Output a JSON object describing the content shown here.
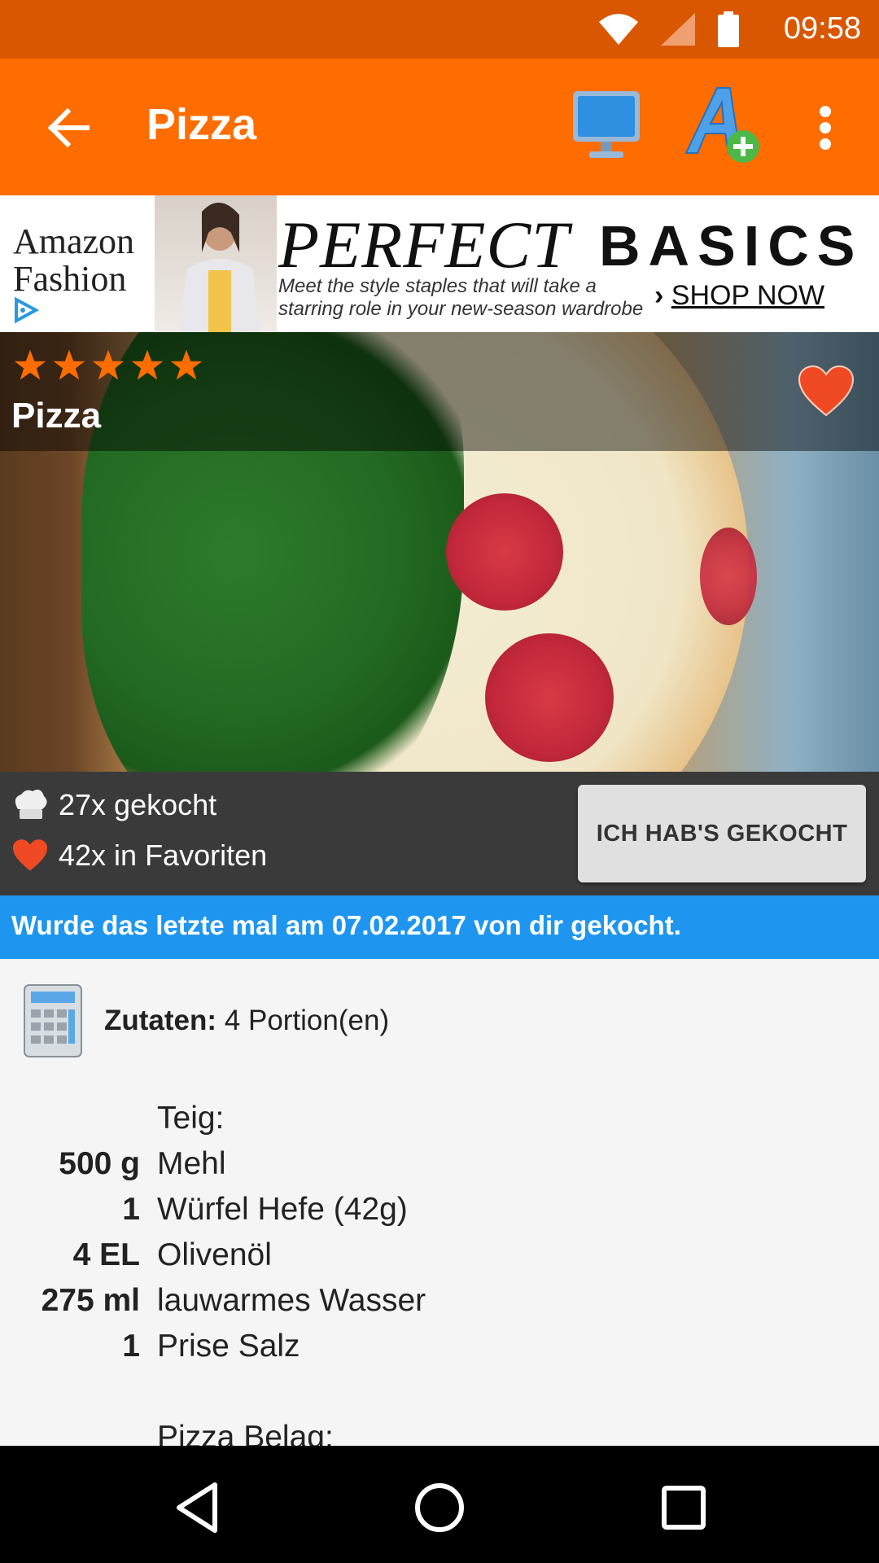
{
  "status_bar": {
    "time": "09:58",
    "wifi_icon": "wifi-icon",
    "signal_icon": "signal-icon",
    "battery_icon": "battery-icon"
  },
  "app_bar": {
    "title": "Pizza",
    "back_icon": "arrow-back-icon",
    "tv_icon": "monitor-icon",
    "font_icon": "font-size-plus-icon",
    "more_icon": "more-vert-icon",
    "color": "#ff6d00"
  },
  "ad": {
    "brand": "Amazon Fashion",
    "headline_1": "PERFECT",
    "headline_2": "BASICS",
    "subtext": "Meet the style staples that will take a starring role in your new-season wardrobe",
    "cta": "SHOP NOW",
    "cta_prefix": "›"
  },
  "recipe": {
    "title": "Pizza",
    "rating": 5,
    "rating_max": 5,
    "star_color": "#ff6d00",
    "favorited": true
  },
  "stats": {
    "cooked_count": "27x gekocht",
    "favorites_count": "42x in Favoriten",
    "cooked_button": "ICH HAB'S GEKOCHT"
  },
  "info_bar": {
    "text": "Wurde das letzte mal am 07.02.2017 von dir gekocht.",
    "color": "#1e96f0"
  },
  "ingredients": {
    "label": "Zutaten:",
    "portions": "4 Portion(en)",
    "items": [
      {
        "qty": "",
        "name": "Teig:"
      },
      {
        "qty": "500 g",
        "name": "Mehl"
      },
      {
        "qty": "1",
        "name": "Würfel Hefe (42g)"
      },
      {
        "qty": "4 EL",
        "name": "Olivenöl"
      },
      {
        "qty": "275 ml",
        "name": "lauwarmes Wasser"
      },
      {
        "qty": "1",
        "name": "Prise Salz"
      },
      {
        "qty": "",
        "name": ""
      },
      {
        "qty": "",
        "name": "Pizza Belag:"
      }
    ]
  },
  "nav_bar": {
    "back": "nav-back-icon",
    "home": "nav-home-icon",
    "recents": "nav-recents-icon"
  }
}
